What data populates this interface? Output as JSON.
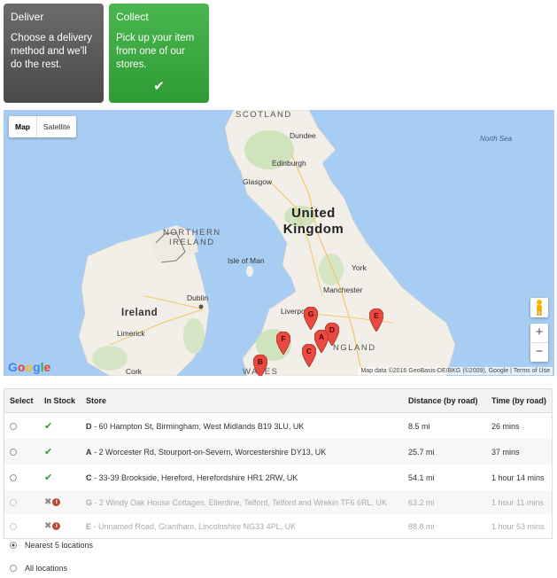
{
  "options": {
    "deliver": {
      "title": "Deliver",
      "description": "Choose a delivery method and we'll do the rest."
    },
    "collect": {
      "title": "Collect",
      "description": "Pick up your item from one of our stores.",
      "check": "✔"
    }
  },
  "map": {
    "type_map": "Map",
    "type_satellite": "Satellite",
    "zoom_in": "+",
    "zoom_out": "−",
    "credits": "Map data ©2016 GeoBasis-DE/BKG (©2009), Google | Terms of Use",
    "logo": "Google",
    "labels": {
      "scotland": "SCOTLAND",
      "dundee": "Dundee",
      "north_sea": "North Sea",
      "edinburgh": "Edinburgh",
      "glasgow": "Glasgow",
      "uk_line1": "United",
      "uk_line2": "Kingdom",
      "ni_line1": "NORTHERN",
      "ni_line2": "IRELAND",
      "isle_of_man": "Isle of Man",
      "york": "York",
      "dublin": "Dublin",
      "ireland": "Ireland",
      "manchester": "Manchester",
      "liverpool": "Liverpool",
      "england": "NGLAND",
      "limerick": "Limerick",
      "cork": "Cork",
      "wales": "WALES"
    },
    "markers": {
      "a": "A",
      "b": "B",
      "c": "C",
      "d": "D",
      "e": "E",
      "f": "F",
      "g": "G"
    },
    "colors": {
      "water": "#a8cdf2",
      "land": "#f2efe9",
      "marker": "#e84a3f"
    }
  },
  "table": {
    "headers": {
      "select": "Select",
      "in_stock": "In Stock",
      "store": "Store",
      "distance": "Distance (by road)",
      "time": "Time (by road)"
    },
    "rows": [
      {
        "letter": "D",
        "address": " - 60 Hampton St, Birmingham, West Midlands B19 3LU, UK",
        "distance": "8.5 mi",
        "time": "26 mins"
      },
      {
        "letter": "A",
        "address": " - 2 Worcester Rd, Stourport-on-Severn, Worcestershire DY13, UK",
        "distance": "25.7 mi",
        "time": "37 mins"
      },
      {
        "letter": "C",
        "address": " - 33-39 Brookside, Hereford, Herefordshire HR1 2RW, UK",
        "distance": "54.1 mi",
        "time": "1 hour 14 mins"
      },
      {
        "letter": "G",
        "address": " - 2 Windy Oak House Cottages, Ellerdine, Telford, Telford and Wrekin TF6 6RL, UK",
        "distance": "63.2 mi",
        "time": "1 hour 11 mins"
      },
      {
        "letter": "E",
        "address": " - Unnamed Road, Grantham, Lincolnshire NG33 4PL, UK",
        "distance": "88.8 mi",
        "time": "1 hour 53 mins"
      }
    ]
  },
  "filters": {
    "nearest": "Nearest 5 locations",
    "all": "All locations"
  }
}
